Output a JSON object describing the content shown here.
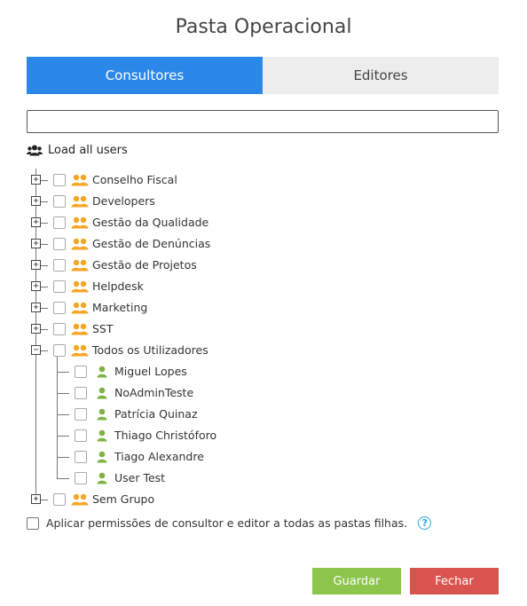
{
  "title": "Pasta Operacional",
  "tabs": [
    {
      "label": "Consultores",
      "active": true
    },
    {
      "label": "Editores",
      "active": false
    }
  ],
  "search": {
    "value": "",
    "placeholder": ""
  },
  "load_all_label": "Load all users",
  "groups": [
    {
      "label": "Conselho Fiscal"
    },
    {
      "label": "Developers"
    },
    {
      "label": "Gestão da Qualidade"
    },
    {
      "label": "Gestão de Denúncias"
    },
    {
      "label": "Gestão de Projetos"
    },
    {
      "label": "Helpdesk"
    },
    {
      "label": "Marketing"
    },
    {
      "label": "SST"
    },
    {
      "label": "Todos os Utilizadores",
      "expanded": true
    },
    {
      "label": "Sem Grupo"
    }
  ],
  "users": [
    {
      "label": "Miguel Lopes"
    },
    {
      "label": "NoAdminTeste"
    },
    {
      "label": "Patrícia Quinaz"
    },
    {
      "label": "Thiago Christóforo"
    },
    {
      "label": "Tiago Alexandre"
    },
    {
      "label": "User Test"
    }
  ],
  "apply_label": "Aplicar permissões de consultor e editor a todas as pastas filhas.",
  "help_symbol": "?",
  "buttons": {
    "save": "Guardar",
    "close": "Fechar"
  },
  "colors": {
    "tab_active": "#2b87e8",
    "group_icon": "#f5a623",
    "user_icon": "#7cb342",
    "save": "#8cc44c",
    "close": "#d9534f"
  }
}
